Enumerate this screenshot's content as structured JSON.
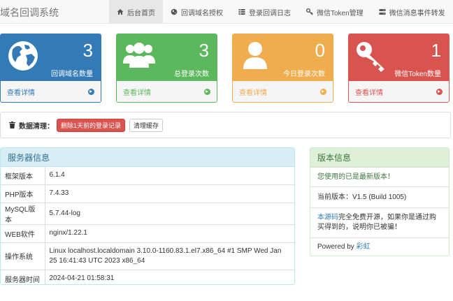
{
  "brand": "域名回调系统",
  "nav": [
    {
      "label": "后台首页",
      "icon": "home-icon",
      "active": true
    },
    {
      "label": "回调域名授权",
      "icon": "globe-icon"
    },
    {
      "label": "登录回调日志",
      "icon": "list-icon"
    },
    {
      "label": "微信Token管理",
      "icon": "key-icon"
    },
    {
      "label": "微信消息事件转发",
      "icon": "server-icon"
    }
  ],
  "cards": [
    {
      "value": "3",
      "label": "回调域名数量",
      "link": "查看详情",
      "icon": "globe-icon",
      "color": "#337ab7"
    },
    {
      "value": "3",
      "label": "总登录次数",
      "link": "查看详情",
      "icon": "users-icon",
      "color": "#5cb85c"
    },
    {
      "value": "0",
      "label": "今日登录次数",
      "link": "查看详情",
      "icon": "user-icon",
      "color": "#f0ad4e"
    },
    {
      "value": "1",
      "label": "微信Token数量",
      "link": "查看详情",
      "icon": "key-icon",
      "color": "#d9534f"
    }
  ],
  "cleanup": {
    "label": "数据清理：",
    "delete_button": "删除1天前的登录记录",
    "clear_cache_button": "清理缓存"
  },
  "server": {
    "title": "服务器信息",
    "rows": [
      {
        "key": "框架版本",
        "value": "6.1.4"
      },
      {
        "key": "PHP版本",
        "value": "7.4.33"
      },
      {
        "key": "MySQL版本",
        "value": "5.7.44-log"
      },
      {
        "key": "WEB软件",
        "value": "nginx/1.22.1"
      },
      {
        "key": "操作系统",
        "value": "Linux localhost.localdomain 3.10.0-1160.83.1.el7.x86_64 #1 SMP Wed Jan 25 16:41:43 UTC 2023 x86_64"
      },
      {
        "key": "服务器时间",
        "value": "2024-04-21 01:58:31"
      }
    ]
  },
  "version": {
    "title": "版本信息",
    "latest": "您使用的已是最新版本！",
    "current": "当前版本：V1.5 (Build 1005)",
    "source_link": "本源码",
    "source_text": "完全免费开源，如果你是通过购买得到的，说明你已被骗！",
    "powered_prefix": "Powered by ",
    "powered_link": "彩虹"
  }
}
